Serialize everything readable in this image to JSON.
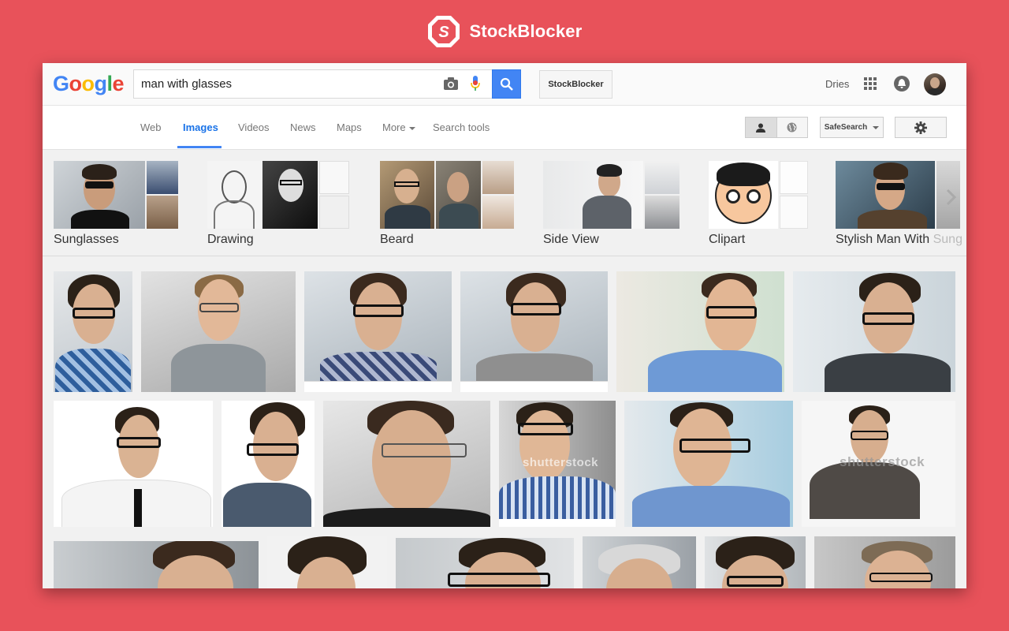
{
  "brand": {
    "name": "StockBlocker",
    "accent": "#e8525a"
  },
  "google": {
    "letters": [
      {
        "ch": "G",
        "color": "#4285f4"
      },
      {
        "ch": "o",
        "color": "#ea4335"
      },
      {
        "ch": "o",
        "color": "#fbbc05"
      },
      {
        "ch": "g",
        "color": "#4285f4"
      },
      {
        "ch": "l",
        "color": "#34a853"
      },
      {
        "ch": "e",
        "color": "#ea4335"
      }
    ]
  },
  "search": {
    "value": "man with glasses",
    "icons": [
      "camera-icon",
      "microphone-icon",
      "search-icon"
    ]
  },
  "extension_button": {
    "label": "StockBlocker"
  },
  "account": {
    "name": "Dries",
    "icons": [
      "apps-grid-icon",
      "notifications-icon",
      "avatar"
    ]
  },
  "nav": {
    "tabs": [
      "Web",
      "Images",
      "Videos",
      "News",
      "Maps",
      "More",
      "Search tools"
    ],
    "active": "Images"
  },
  "tools": {
    "safesearch_label": "SafeSearch",
    "icons": [
      "person-icon",
      "globe-icon",
      "gear-icon"
    ]
  },
  "related": [
    {
      "label": "Sunglasses"
    },
    {
      "label": "Drawing"
    },
    {
      "label": "Beard"
    },
    {
      "label": "Side View"
    },
    {
      "label": "Clipart"
    },
    {
      "label": "Stylish Man With",
      "label_faded": "Sung"
    }
  ],
  "watermarks": {
    "shutterstock": "shutterstock"
  },
  "colors": {
    "google_blue": "#4285f4",
    "active_tab": "#1a73e8"
  }
}
